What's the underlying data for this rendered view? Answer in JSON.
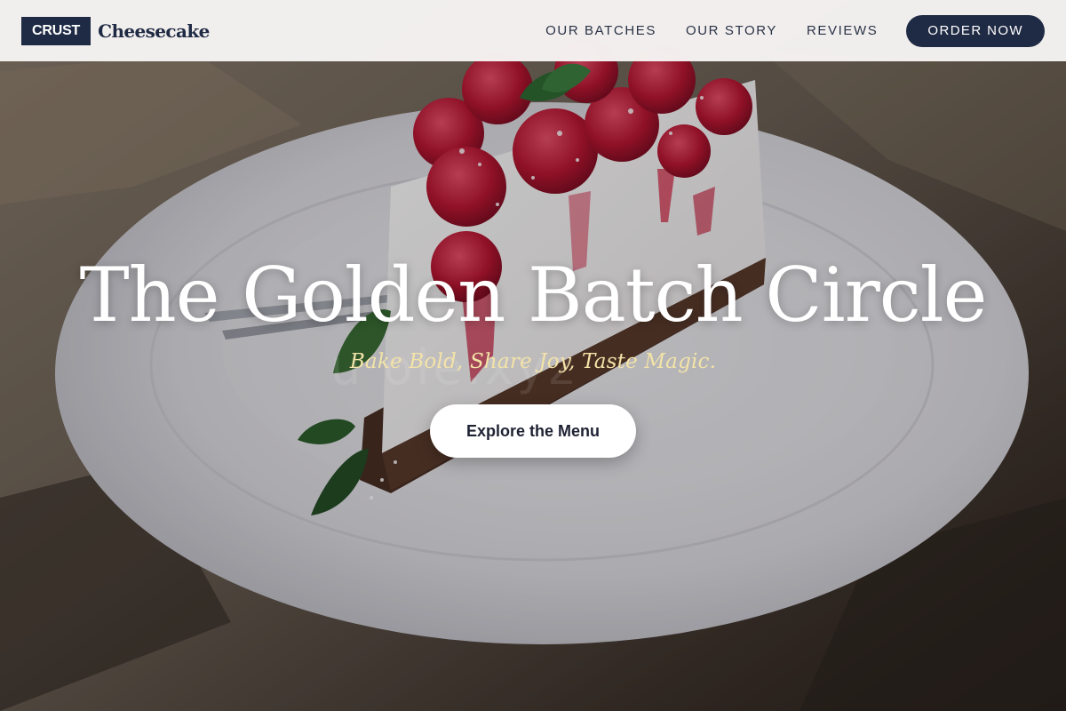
{
  "header": {
    "brand_badge": "CRUST",
    "brand_name": "Cheesecake",
    "nav": [
      "OUR BATCHES",
      "OUR STORY",
      "REVIEWS"
    ],
    "cta": "ORDER NOW"
  },
  "hero": {
    "title": "The Golden Batch Circle",
    "tagline": "Bake Bold, Share Joy, Taste Magic.",
    "button": "Explore the Menu",
    "watermark": "u          ole.xyz"
  },
  "colors": {
    "brand_navy": "#1f2a44",
    "tagline_gold": "#f3e3a8",
    "raspberry": "#c21f3a",
    "plate": "#e7e6ea"
  },
  "icons": [
    "cheesecake-photo",
    "fork-icon",
    "mint-leaf-icon",
    "raspberry-icon"
  ]
}
